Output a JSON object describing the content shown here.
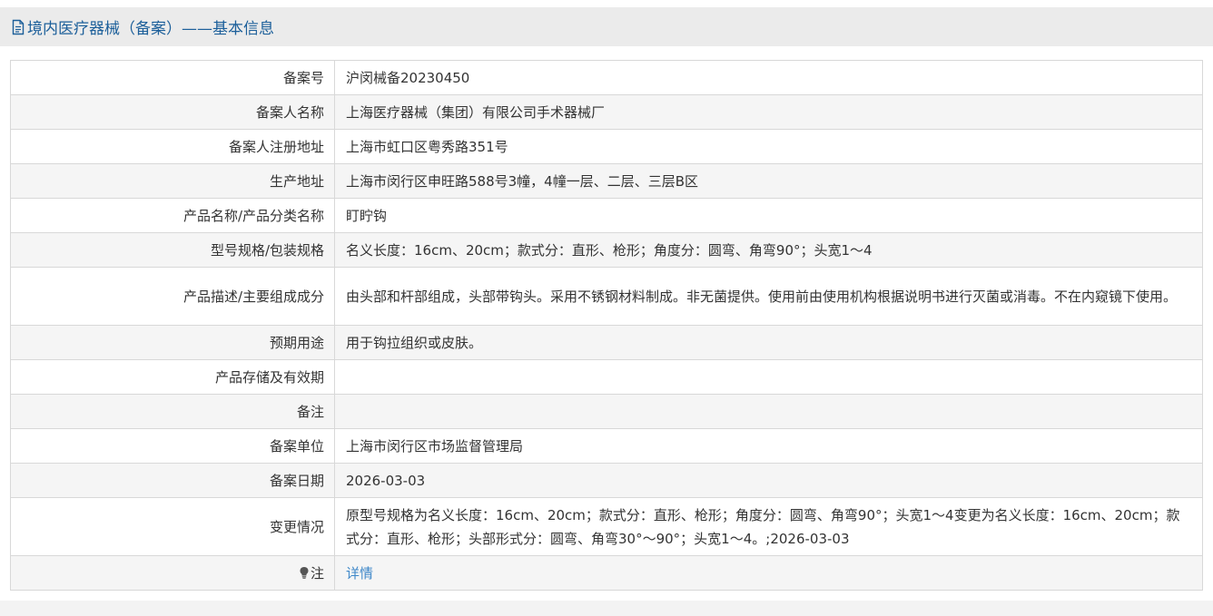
{
  "header": {
    "title": "境内医疗器械（备案）——基本信息",
    "icon": "document-icon",
    "color": "#1c5f9a"
  },
  "rows": [
    {
      "label": "备案号",
      "value": "沪闵械备20230450"
    },
    {
      "label": "备案人名称",
      "value": "上海医疗器械（集团）有限公司手术器械厂"
    },
    {
      "label": "备案人注册地址",
      "value": "上海市虹口区粤秀路351号"
    },
    {
      "label": "生产地址",
      "value": "上海市闵行区申旺路588号3幢，4幢一层、二层、三层B区"
    },
    {
      "label": "产品名称/产品分类名称",
      "value": "盯眝钩"
    },
    {
      "label": "型号规格/包装规格",
      "value": "名义长度：16cm、20cm；款式分：直形、枪形；角度分：圆弯、角弯90°；头宽1～4"
    },
    {
      "label": "产品描述/主要组成成分",
      "value": "由头部和杆部组成，头部带钩头。采用不锈钢材料制成。非无菌提供。使用前由使用机构根据说明书进行灭菌或消毒。不在内窥镜下使用。"
    },
    {
      "label": "预期用途",
      "value": "用于钩拉组织或皮肤。"
    },
    {
      "label": "产品存储及有效期",
      "value": ""
    },
    {
      "label": "备注",
      "value": ""
    },
    {
      "label": "备案单位",
      "value": "上海市闵行区市场监督管理局"
    },
    {
      "label": "备案日期",
      "value": "2026-03-03"
    },
    {
      "label": "变更情况",
      "value": "原型号规格为名义长度：16cm、20cm；款式分：直形、枪形；角度分：圆弯、角弯90°；头宽1～4变更为名义长度：16cm、20cm；款式分：直形、枪形；头部形式分：圆弯、角弯30°～90°；头宽1～4。;2026-03-03"
    }
  ],
  "note": {
    "label": "注",
    "icon": "lightbulb-icon",
    "link_text": "详情",
    "link_color": "#3f88c9"
  }
}
